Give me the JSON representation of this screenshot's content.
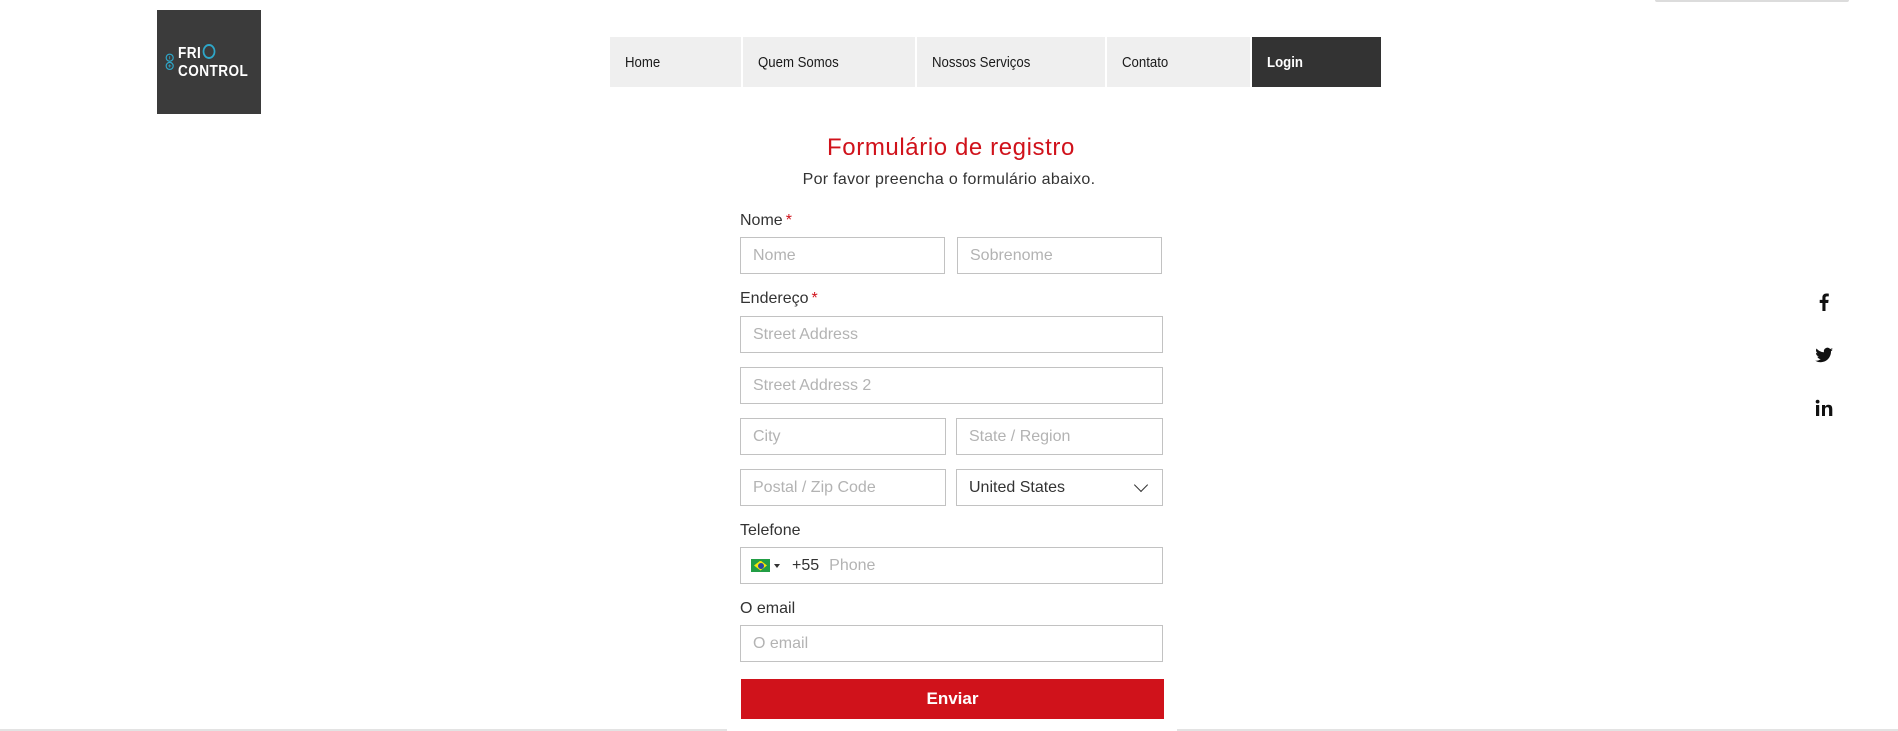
{
  "logo": {
    "line1": "FRI",
    "line2": "CONTROL",
    "icon": "frio-control-logo-icon",
    "bg_color": "#3b3b3b",
    "accent_color": "#2ea7c9"
  },
  "nav": {
    "items": [
      {
        "label": "Home"
      },
      {
        "label": "Quem Somos"
      },
      {
        "label": "Nossos Serviços"
      },
      {
        "label": "Contato"
      },
      {
        "label": "Login",
        "active": true
      }
    ]
  },
  "form": {
    "title": "Formulário de registro",
    "subtitle": "Por favor preencha o formulário abaixo.",
    "name": {
      "label": "Nome",
      "required_mark": "*",
      "first_placeholder": "Nome",
      "last_placeholder": "Sobrenome"
    },
    "address": {
      "label": "Endereço",
      "required_mark": "*",
      "street_placeholder": "Street Address",
      "street2_placeholder": "Street Address 2",
      "city_placeholder": "City",
      "state_placeholder": "State / Region",
      "zip_placeholder": "Postal / Zip Code",
      "country_value": "United States"
    },
    "phone": {
      "label": "Telefone",
      "flag": "brazil-flag-icon",
      "dial_code": "+55",
      "placeholder": "Phone"
    },
    "email": {
      "label": "O email",
      "placeholder": "O email"
    },
    "submit_label": "Enviar"
  },
  "social": [
    "facebook-icon",
    "twitter-icon",
    "linkedin-icon"
  ],
  "colors": {
    "accent": "#d0121b",
    "nav_bg": "#efefef",
    "nav_active_bg": "#333333",
    "field_border": "#c2c2c2"
  }
}
